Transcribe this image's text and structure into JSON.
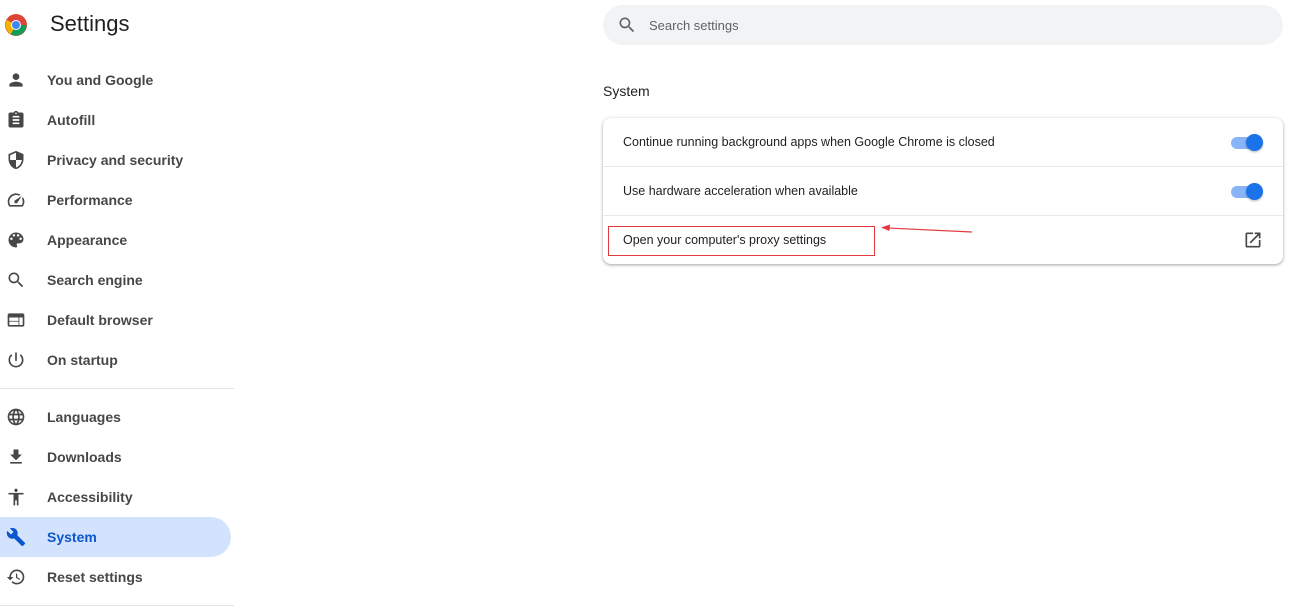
{
  "app": {
    "title": "Settings"
  },
  "search": {
    "placeholder": "Search settings",
    "value": ""
  },
  "sidebar": {
    "items": [
      {
        "label": "You and Google",
        "icon": "person-icon"
      },
      {
        "label": "Autofill",
        "icon": "clipboard-icon"
      },
      {
        "label": "Privacy and security",
        "icon": "shield-icon"
      },
      {
        "label": "Performance",
        "icon": "speedometer-icon"
      },
      {
        "label": "Appearance",
        "icon": "palette-icon"
      },
      {
        "label": "Search engine",
        "icon": "search-icon"
      },
      {
        "label": "Default browser",
        "icon": "browser-window-icon"
      },
      {
        "label": "On startup",
        "icon": "power-icon"
      }
    ],
    "items2": [
      {
        "label": "Languages",
        "icon": "globe-icon"
      },
      {
        "label": "Downloads",
        "icon": "download-icon"
      },
      {
        "label": "Accessibility",
        "icon": "accessibility-icon"
      },
      {
        "label": "System",
        "icon": "wrench-icon",
        "active": true
      },
      {
        "label": "Reset settings",
        "icon": "history-icon"
      }
    ]
  },
  "section": {
    "title": "System",
    "rows": [
      {
        "label": "Continue running background apps when Google Chrome is closed",
        "control": "toggle",
        "on": true
      },
      {
        "label": "Use hardware acceleration when available",
        "control": "toggle",
        "on": true
      },
      {
        "label": "Open your computer's proxy settings",
        "control": "external-link-icon"
      }
    ]
  },
  "colors": {
    "accent": "#0b57d0",
    "active_bg": "#d3e3fd",
    "toggle_on": "#1a73e8",
    "annotation": "#e0393e"
  }
}
